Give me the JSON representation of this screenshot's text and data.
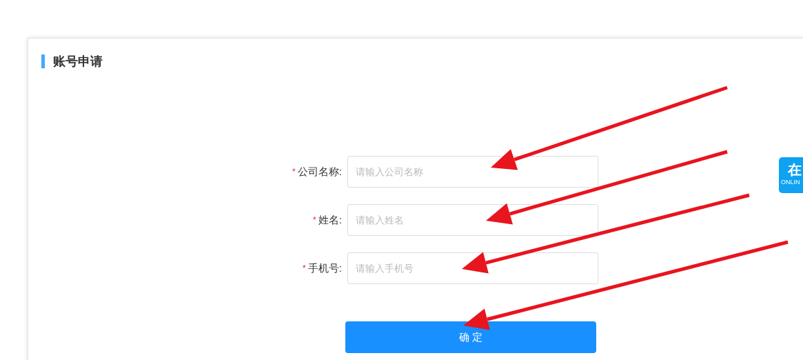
{
  "panel": {
    "title": "账号申请"
  },
  "form": {
    "fields": [
      {
        "label": "公司名称",
        "required_mark": "*",
        "colon": ":",
        "placeholder": "请输入公司名称"
      },
      {
        "label": "姓名",
        "required_mark": "*",
        "colon": ":",
        "placeholder": "请输入姓名"
      },
      {
        "label": "手机号",
        "required_mark": "*",
        "colon": ":",
        "placeholder": "请输入手机号"
      }
    ],
    "submit": "确 定"
  },
  "online_badge": {
    "label": "在",
    "sublabel": "ONLIN"
  }
}
